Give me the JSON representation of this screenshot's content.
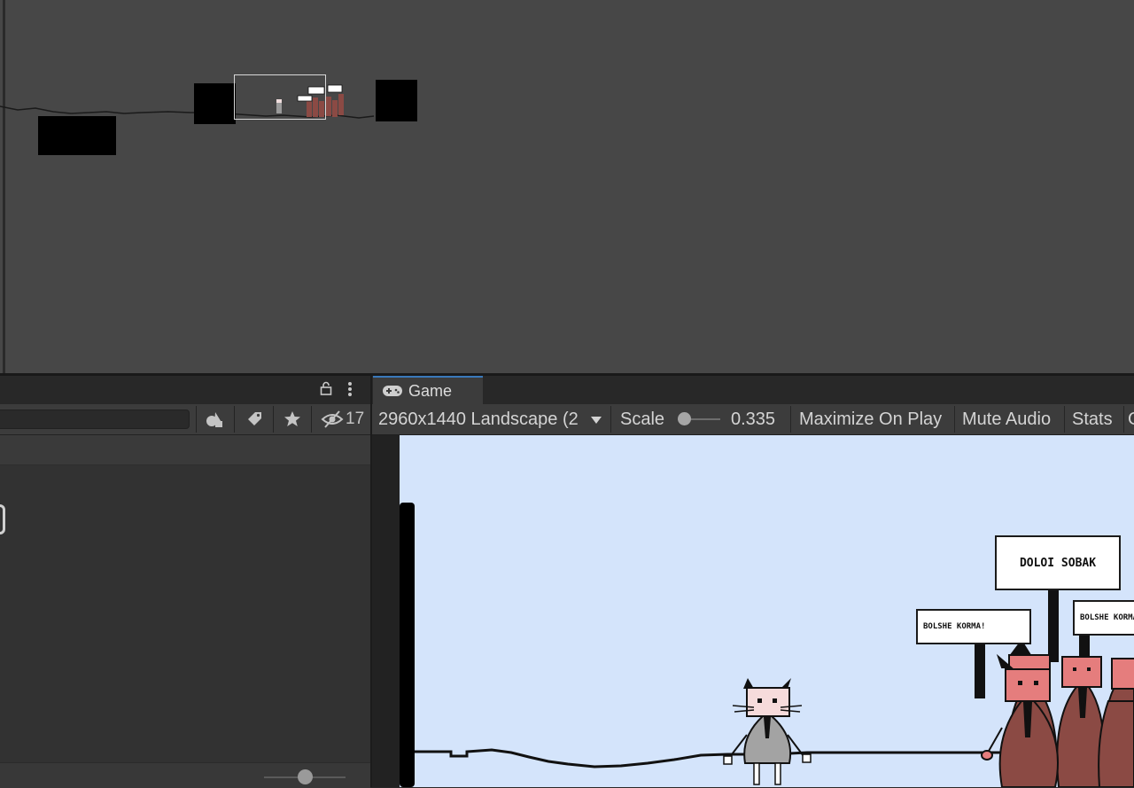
{
  "scene_view": {
    "minimap_signs": [
      "▪▪▪",
      "···"
    ]
  },
  "left_panel": {
    "lock_icon": "lock-icon",
    "menu_icon": "kebab-menu-icon",
    "search": {
      "value": "",
      "placeholder": ""
    },
    "hidden_count": "17",
    "filter_icons": [
      "filter-by-type-icon",
      "filter-by-label-icon",
      "favorites-icon",
      "hidden-packages-icon"
    ]
  },
  "game_view": {
    "tab_label": "Game",
    "tab_icon": "gamepad-icon",
    "resolution": "2960x1440 Landscape (2",
    "scale_label": "Scale",
    "scale_value": "0.335",
    "maximize_label": "Maximize On Play",
    "mute_label": "Mute Audio",
    "stats_label": "Stats",
    "gizmos_label": "Gizmos",
    "signs": {
      "main": "DOLOI SOBAK",
      "left": "BOLSHE KORMA!",
      "right": "BOLSHE KORMA!"
    }
  },
  "colors": {
    "accent": "#3a79bb",
    "sky": "#d4e4fb",
    "protester_cat": "#8b4a44",
    "protester_face": "#e57d7d",
    "player_cat_body": "#a3a3a3",
    "player_cat_face": "#f6dbdb"
  }
}
